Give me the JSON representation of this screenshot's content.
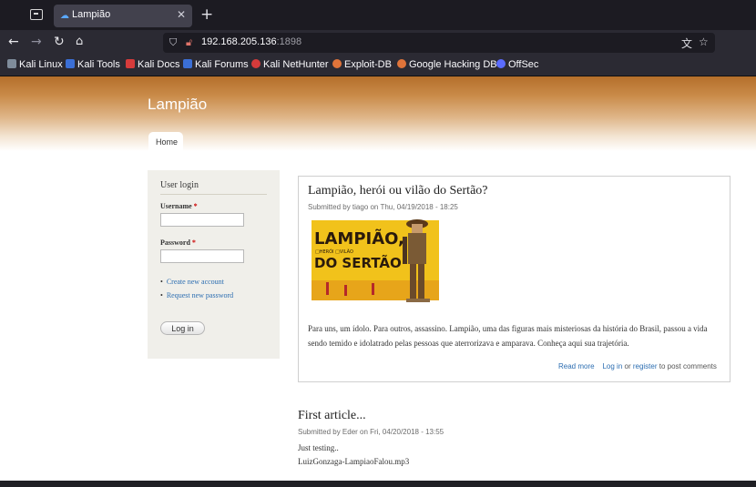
{
  "browser": {
    "tab_title": "Lampião",
    "url_host": "192.168.205.136",
    "url_port": ":1898",
    "bookmarks": [
      {
        "label": "Kali Linux",
        "color": "#7f8c9b"
      },
      {
        "label": "Kali Tools",
        "color": "#3b6fd6"
      },
      {
        "label": "Kali Docs",
        "color": "#d63b3b"
      },
      {
        "label": "Kali Forums",
        "color": "#3b6fd6"
      },
      {
        "label": "Kali NetHunter",
        "color": "#d63b3b"
      },
      {
        "label": "Exploit-DB",
        "color": "#e0743a"
      },
      {
        "label": "Google Hacking DB",
        "color": "#e0743a"
      },
      {
        "label": "OffSec",
        "color": "#5b6cff"
      }
    ]
  },
  "site": {
    "name": "Lampião",
    "nav_home": "Home"
  },
  "login": {
    "title": "User login",
    "username_label": "Username",
    "password_label": "Password",
    "required_mark": "*",
    "create_account": "Create new account",
    "request_password": "Request new password",
    "submit": "Log in"
  },
  "article1": {
    "title": "Lampião, herói ou vilão do Sertão?",
    "meta": "Submitted by tiago on Thu, 04/19/2018 - 18:25",
    "image_text_1": "LAMPIÃO,",
    "image_text_2": "□HERÓI □VILÃO",
    "image_text_3": "DO SERTÃO",
    "body": "Para uns, um ídolo. Para outros, assassino. Lampião, uma das figuras mais misteriosas da história do Brasil, passou a vida sendo temido e idolatrado pelas pessoas que aterrorizava e amparava. Conheça aqui sua trajetória.",
    "read_more": "Read more",
    "log_in": "Log in",
    "or": " or ",
    "register": "register",
    "to_post": " to post comments"
  },
  "article2": {
    "title": "First article...",
    "meta": "Submitted by Eder on Fri, 04/20/2018 - 13:55",
    "line1": "Just testing..",
    "line2": "LuizGonzaga-LampiaoFalou.mp3"
  },
  "colors": {
    "banner": "#b46f2b",
    "link": "#2b6db1",
    "required": "#cc0000"
  }
}
